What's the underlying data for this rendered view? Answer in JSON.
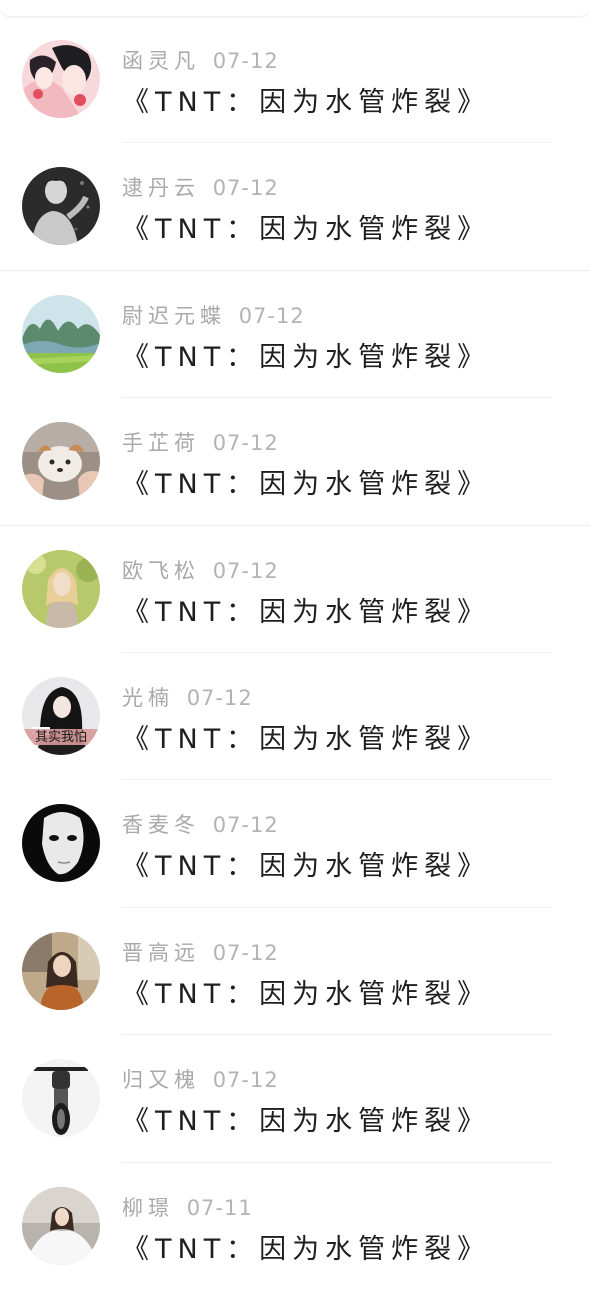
{
  "conversations": [
    {
      "name": "函灵凡",
      "date": "07-12",
      "message": "《TNT：因为水管炸裂》",
      "avatar": "avatar-anime-girls"
    },
    {
      "name": "逮丹云",
      "date": "07-12",
      "message": "《TNT：因为水管炸裂》",
      "avatar": "avatar-man-bw"
    },
    {
      "name": "尉迟元蝶",
      "date": "07-12",
      "message": "《TNT：因为水管炸裂》",
      "avatar": "avatar-landscape"
    },
    {
      "name": "手芷荷",
      "date": "07-12",
      "message": "《TNT：因为水管炸裂》",
      "avatar": "avatar-puppy"
    },
    {
      "name": "欧飞松",
      "date": "07-12",
      "message": "《TNT：因为水管炸裂》",
      "avatar": "avatar-blonde-woman"
    },
    {
      "name": "光楠",
      "date": "07-12",
      "message": "《TNT：因为水管炸裂》",
      "avatar": "avatar-girl-caption",
      "avatar_caption": "其实我怕"
    },
    {
      "name": "香麦冬",
      "date": "07-12",
      "message": "《TNT：因为水管炸裂》",
      "avatar": "avatar-mask"
    },
    {
      "name": "晋高远",
      "date": "07-12",
      "message": "《TNT：因为水管炸裂》",
      "avatar": "avatar-woman-street"
    },
    {
      "name": "归又槐",
      "date": "07-12",
      "message": "《TNT：因为水管炸裂》",
      "avatar": "avatar-motorcycle"
    },
    {
      "name": "柳璟",
      "date": "07-11",
      "message": "《TNT：因为水管炸裂》",
      "avatar": "avatar-woman-white-dress"
    }
  ]
}
